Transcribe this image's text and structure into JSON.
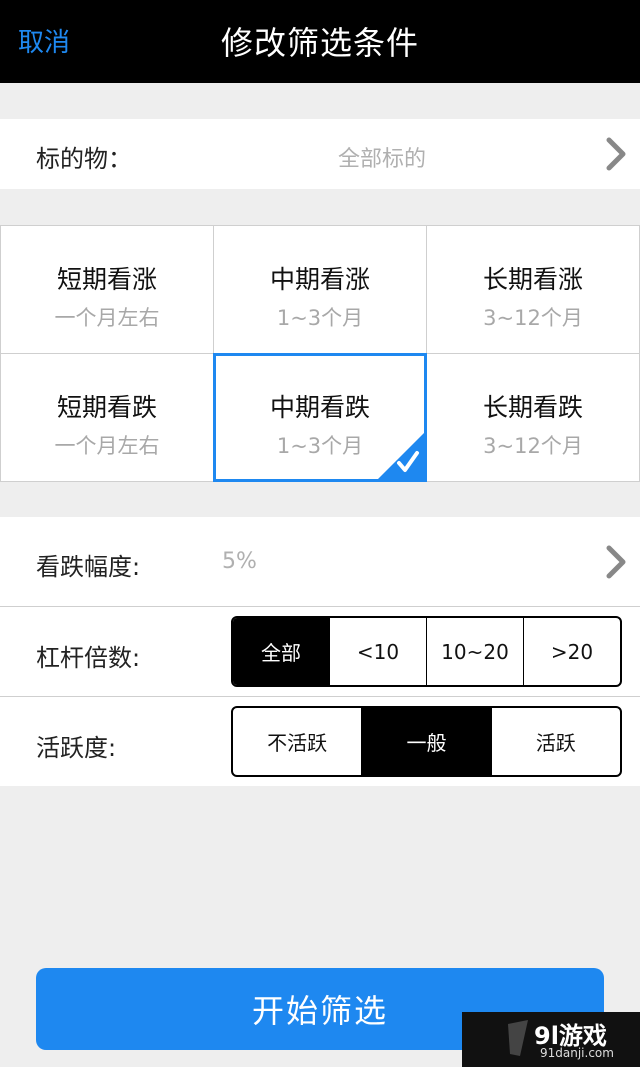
{
  "navbar": {
    "cancel": "取消",
    "title": "修改筛选条件"
  },
  "underlying": {
    "label": "标的物：",
    "value": "全部标的"
  },
  "periods": [
    {
      "title": "短期看涨",
      "sub": "一个月左右",
      "selected": false
    },
    {
      "title": "中期看涨",
      "sub": "1~3个月",
      "selected": false
    },
    {
      "title": "长期看涨",
      "sub": "3~12个月",
      "selected": false
    },
    {
      "title": "短期看跌",
      "sub": "一个月左右",
      "selected": false
    },
    {
      "title": "中期看跌",
      "sub": "1~3个月",
      "selected": true
    },
    {
      "title": "长期看跌",
      "sub": "3~12个月",
      "selected": false
    }
  ],
  "amplitude": {
    "label": "看跌幅度:",
    "value": "5%"
  },
  "leverage": {
    "label": "杠杆倍数:",
    "options": [
      "全部",
      "<10",
      "10~20",
      ">20"
    ],
    "selected": 0
  },
  "activity": {
    "label": "活跃度:",
    "options": [
      "不活跃",
      "一般",
      "活跃"
    ],
    "selected": 1
  },
  "start_button": "开始筛选",
  "watermark": {
    "logo": "9l游戏",
    "url": "91danji.com"
  },
  "colors": {
    "accent": "#1e88f0",
    "navbar": "#000000",
    "background": "#eeeeee"
  }
}
